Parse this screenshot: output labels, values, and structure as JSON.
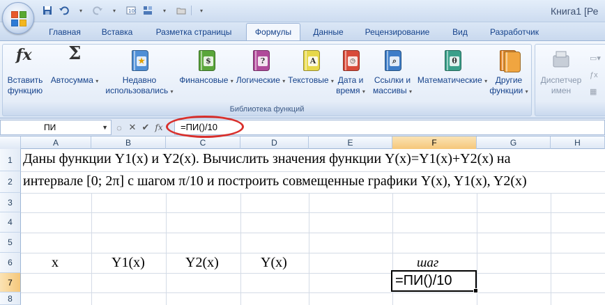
{
  "window": {
    "title": "Книга1  [Ре"
  },
  "quick_access": {
    "icons": [
      "save-icon",
      "undo-icon",
      "redo-icon",
      "format-icon",
      "layout-icon",
      "folder-icon",
      "customize-icon"
    ]
  },
  "tabs": [
    {
      "label": "Главная"
    },
    {
      "label": "Вставка"
    },
    {
      "label": "Разметка страницы"
    },
    {
      "label": "Формулы",
      "active": true
    },
    {
      "label": "Данные"
    },
    {
      "label": "Рецензирование"
    },
    {
      "label": "Вид"
    },
    {
      "label": "Разработчик"
    }
  ],
  "ribbon": {
    "function_library": {
      "label": "Библиотека функций",
      "insert_function": {
        "line1": "Вставить",
        "line2": "функцию"
      },
      "autosum": {
        "line1": "Автосумма"
      },
      "recent": {
        "line1": "Недавно",
        "line2": "использовались"
      },
      "financial": {
        "line1": "Финансовые"
      },
      "logical": {
        "line1": "Логические"
      },
      "text": {
        "line1": "Текстовые"
      },
      "datetime": {
        "line1": "Дата и",
        "line2": "время"
      },
      "lookup": {
        "line1": "Ссылки и",
        "line2": "массивы"
      },
      "math": {
        "line1": "Математические"
      },
      "other": {
        "line1": "Другие",
        "line2": "функции"
      }
    },
    "names": {
      "manager": {
        "line1": "Диспетчер",
        "line2": "имен"
      }
    }
  },
  "formula_bar": {
    "name_box": "ПИ",
    "formula": "=ПИ()/10",
    "fx_symbol": "fx"
  },
  "columns": [
    "A",
    "B",
    "C",
    "D",
    "E",
    "F",
    "G",
    "H"
  ],
  "rows": [
    "1",
    "2",
    "3",
    "4",
    "5",
    "6",
    "7",
    "8"
  ],
  "cells": {
    "row1": "Даны функции Y1(x) и Y2(x). Вычислить значения функции Y(x)=Y1(x)+Y2(x) на",
    "row2": "интервале [0; 2π] с шагом π/10 и построить совмещенные графики Y(x), Y1(x), Y2(x)",
    "a6": "x",
    "b6": "Y1(x)",
    "c6": "Y2(x)",
    "d6": "Y(x)",
    "f6": "шаг",
    "f7": "=ПИ()/10"
  },
  "colors": {
    "accent": "#15428b",
    "highlight_circle": "#d9302c",
    "selected_header": "#f5c77a"
  }
}
